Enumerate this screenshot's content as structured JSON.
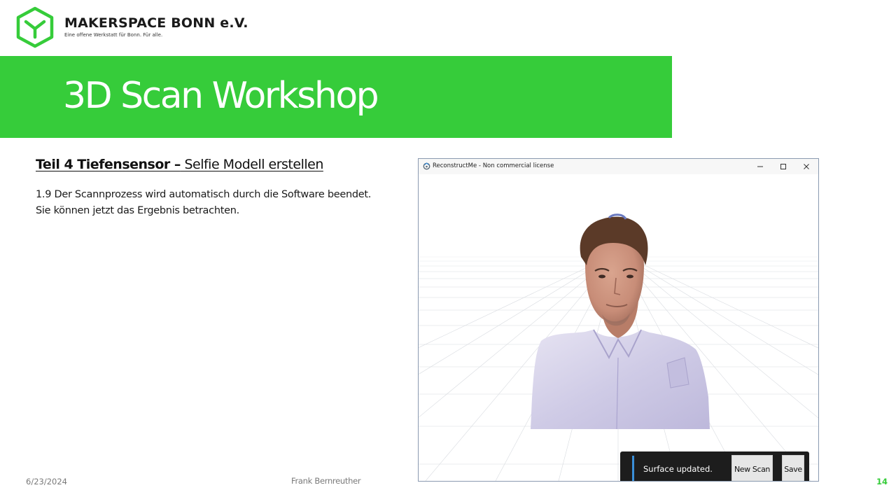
{
  "brand": {
    "name": "MAKERSPACE BONN e.V.",
    "tagline": "Eine offene Werkstatt für Bonn. Für alle.",
    "logo_icon": "hexagon-m-logo-icon",
    "color": "#36cc3a"
  },
  "slide": {
    "title": "3D Scan Workshop",
    "section_prefix_bold": "Teil 4  Tiefensensor  –",
    "section_rest": " Selfie Modell erstellen",
    "body_lines": [
      "1.9 Der Scannprozess wird automatisch durch die Software beendet.",
      "Sie können jetzt das Ergebnis betrachten."
    ]
  },
  "app_window": {
    "title": "ReconstructMe - Non commercial license",
    "app_icon": "reconstructme-app-icon",
    "controls": {
      "minimize_icon": "minimize-icon",
      "maximize_icon": "maximize-icon",
      "close_icon": "close-icon"
    },
    "toast": {
      "message": "Surface updated.",
      "new_scan_label": "New Scan",
      "save_label": "Save",
      "accent_color": "#3a8fd9"
    }
  },
  "footer": {
    "date": "6/23/2024",
    "author": "Frank Bernreuther",
    "page_number": "14"
  }
}
